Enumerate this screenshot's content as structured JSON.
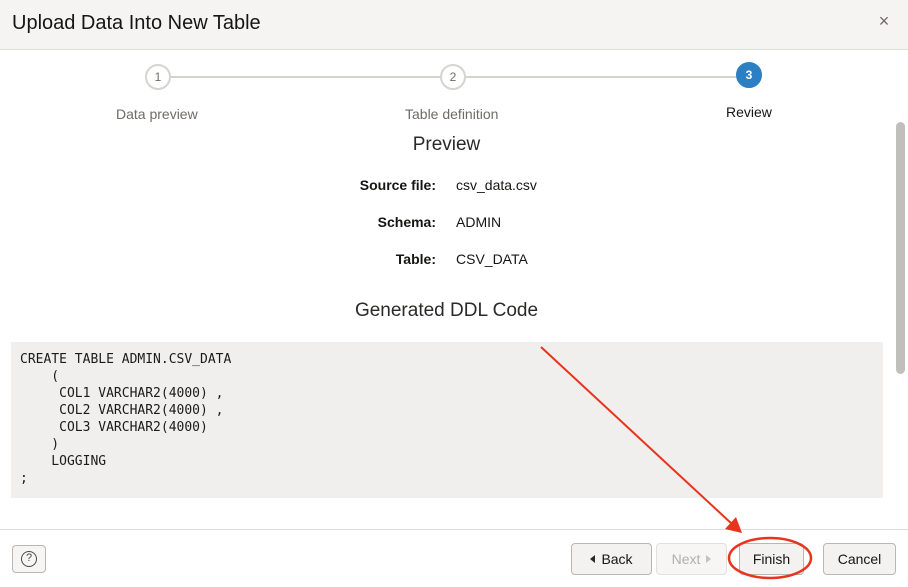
{
  "dialog": {
    "title": "Upload Data Into New Table",
    "close_symbol": "×"
  },
  "steps": [
    {
      "number": "1",
      "label": "Data preview",
      "state": "done"
    },
    {
      "number": "2",
      "label": "Table definition",
      "state": "done"
    },
    {
      "number": "3",
      "label": "Review",
      "state": "active"
    }
  ],
  "preview": {
    "heading": "Preview",
    "source_file_label": "Source file:",
    "source_file_value": "csv_data.csv",
    "schema_label": "Schema:",
    "schema_value": "ADMIN",
    "table_label": "Table:",
    "table_value": "CSV_DATA"
  },
  "ddl": {
    "heading": "Generated DDL Code",
    "lines": [
      "CREATE TABLE ADMIN.CSV_DATA",
      "    (",
      "     COL1 VARCHAR2(4000) ,",
      "     COL2 VARCHAR2(4000) ,",
      "     COL3 VARCHAR2(4000)",
      "    )",
      "    LOGGING",
      ";"
    ]
  },
  "footer": {
    "help_symbol": "?",
    "back_label": "Back",
    "next_label": "Next",
    "finish_label": "Finish",
    "cancel_label": "Cancel"
  },
  "colors": {
    "accent": "#2c7fc3",
    "annotation": "#e8341c"
  }
}
